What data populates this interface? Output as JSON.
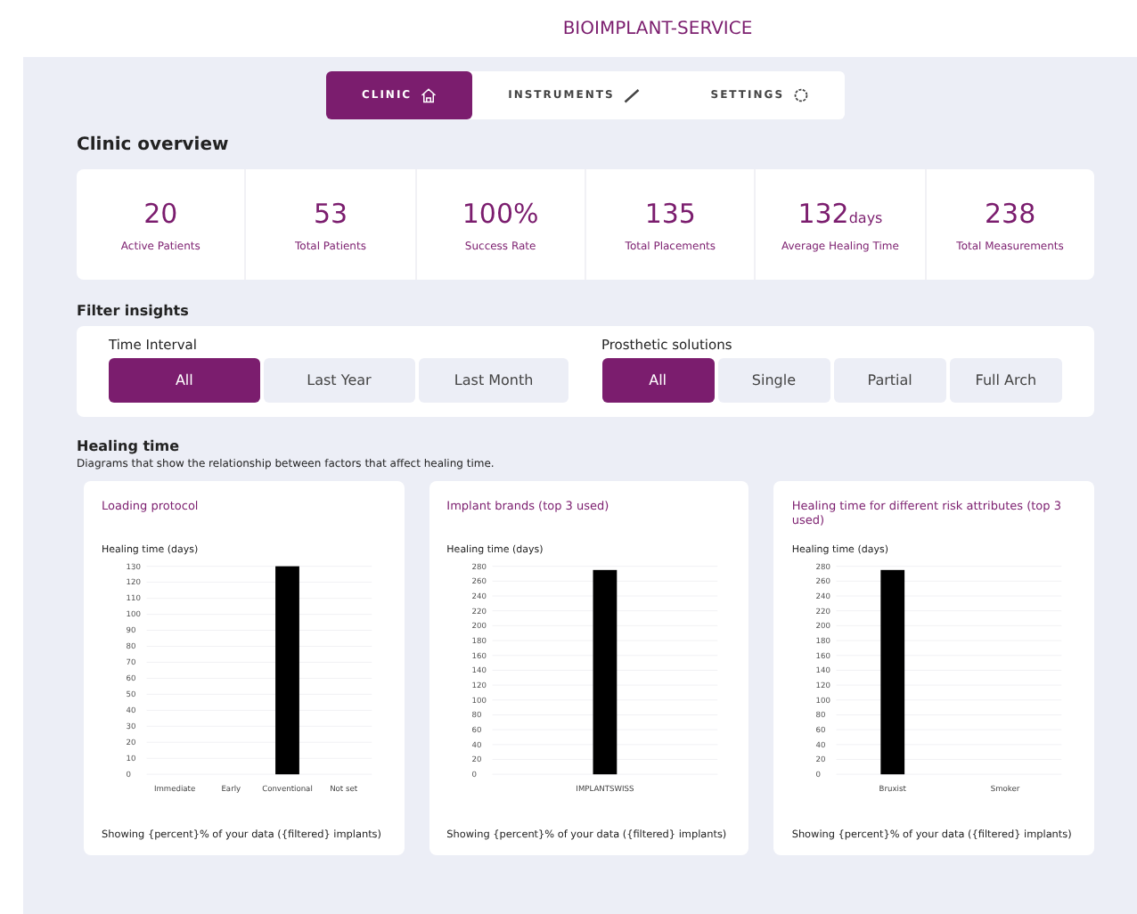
{
  "header": {
    "title": "BIOIMPLANT-SERVICE"
  },
  "tabs": [
    {
      "label": "CLINIC",
      "kind": "house",
      "selected": true
    },
    {
      "label": "INSTRUMENTS",
      "kind": "pen",
      "selected": false
    },
    {
      "label": "SETTINGS",
      "kind": "gear",
      "selected": false
    }
  ],
  "overview": {
    "title": "Clinic overview",
    "stats": [
      {
        "value": "20",
        "label": "Active Patients"
      },
      {
        "value": "53",
        "label": "Total Patients"
      },
      {
        "value": "100%",
        "label": "Success Rate"
      },
      {
        "value": "135",
        "label": "Total Placements"
      },
      {
        "value": "132",
        "unit": "days",
        "label": "Average Healing Time"
      },
      {
        "value": "238",
        "label": "Total Measurements"
      }
    ]
  },
  "filters": {
    "title": "Filter insights",
    "groups": [
      {
        "label": "Time Interval",
        "options": [
          {
            "label": "All",
            "selected": true
          },
          {
            "label": "Last Year",
            "selected": false
          },
          {
            "label": "Last Month",
            "selected": false
          }
        ]
      },
      {
        "label": "Prosthetic solutions",
        "options": [
          {
            "label": "All",
            "selected": true
          },
          {
            "label": "Single",
            "selected": false
          },
          {
            "label": "Partial",
            "selected": false
          },
          {
            "label": "Full Arch",
            "selected": false
          }
        ]
      }
    ]
  },
  "healing": {
    "title": "Healing time",
    "description": "Diagrams that show the relationship between factors that affect healing time.",
    "charts": [
      {
        "title": "Loading protocol",
        "footer": "Showing {percent}% of your data ({filtered} implants)",
        "chart_data": {
          "type": "bar",
          "grid": true,
          "ylabel": "Healing time (days)",
          "categories": [
            "Immediate",
            "Early",
            "Conventional",
            "Not set"
          ],
          "values": [
            null,
            null,
            130,
            null
          ],
          "ylim": [
            0,
            130
          ],
          "yticks": [
            0,
            10,
            20,
            30,
            40,
            50,
            60,
            70,
            80,
            90,
            100,
            110,
            120,
            130
          ]
        }
      },
      {
        "title": "Implant brands (top 3 used)",
        "footer": "Showing {percent}% of your data ({filtered} implants)",
        "chart_data": {
          "type": "bar",
          "grid": true,
          "ylabel": "Healing time (days)",
          "categories": [
            "IMPLANTSWISS"
          ],
          "values": [
            275
          ],
          "ylim": [
            0,
            280
          ],
          "yticks": [
            0,
            20,
            40,
            60,
            80,
            100,
            120,
            140,
            160,
            180,
            200,
            220,
            240,
            260,
            280
          ]
        }
      },
      {
        "title": "Healing time for different risk attributes (top 3 used)",
        "footer": "Showing {percent}% of your data ({filtered} implants)",
        "chart_data": {
          "type": "bar",
          "grid": true,
          "ylabel": "Healing time (days)",
          "categories": [
            "Bruxist",
            "Smoker"
          ],
          "values": [
            275,
            null
          ],
          "ylim": [
            0,
            280
          ],
          "yticks": [
            0,
            20,
            40,
            60,
            80,
            100,
            120,
            140,
            160,
            180,
            200,
            220,
            240,
            260,
            280
          ]
        }
      }
    ]
  }
}
